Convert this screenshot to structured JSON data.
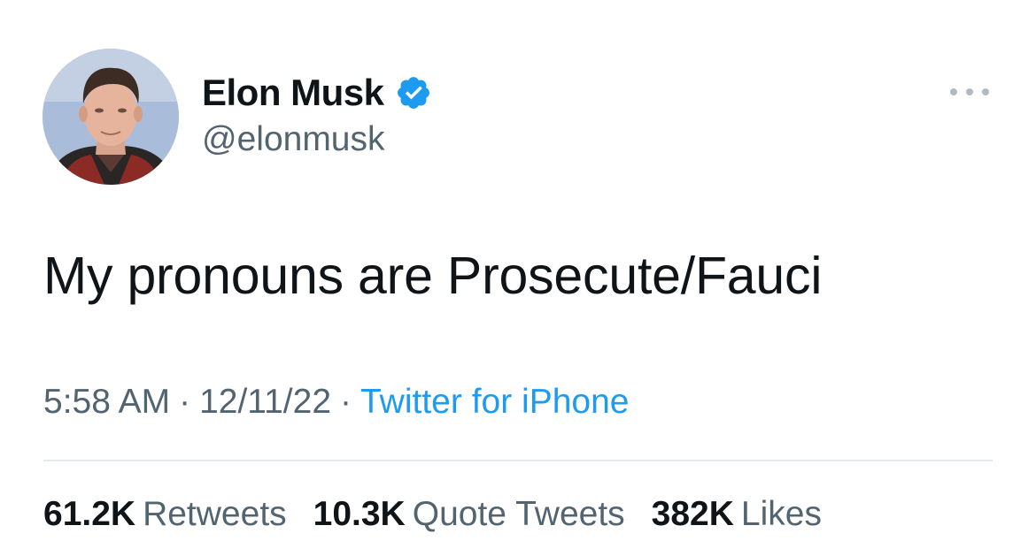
{
  "author": {
    "display_name": "Elon Musk",
    "handle": "@elonmusk",
    "verified": true,
    "verified_color": "#1d9bf0",
    "avatar_icon": "profile-photo"
  },
  "more_icon": "more-horizontal-icon",
  "tweet": {
    "text": "My pronouns are Prosecute/Fauci",
    "time": "5:58 AM",
    "separator": "·",
    "date": "12/11/22",
    "source": "Twitter for iPhone"
  },
  "stats": {
    "retweets_count": "61.2K",
    "retweets_label": "Retweets",
    "quote_tweets_count": "10.3K",
    "quote_tweets_label": "Quote Tweets",
    "likes_count": "382K",
    "likes_label": "Likes"
  },
  "colors": {
    "text_primary": "#0f1419",
    "text_secondary": "#536471",
    "link": "#1d9bf0",
    "divider": "#e6e9eb"
  }
}
